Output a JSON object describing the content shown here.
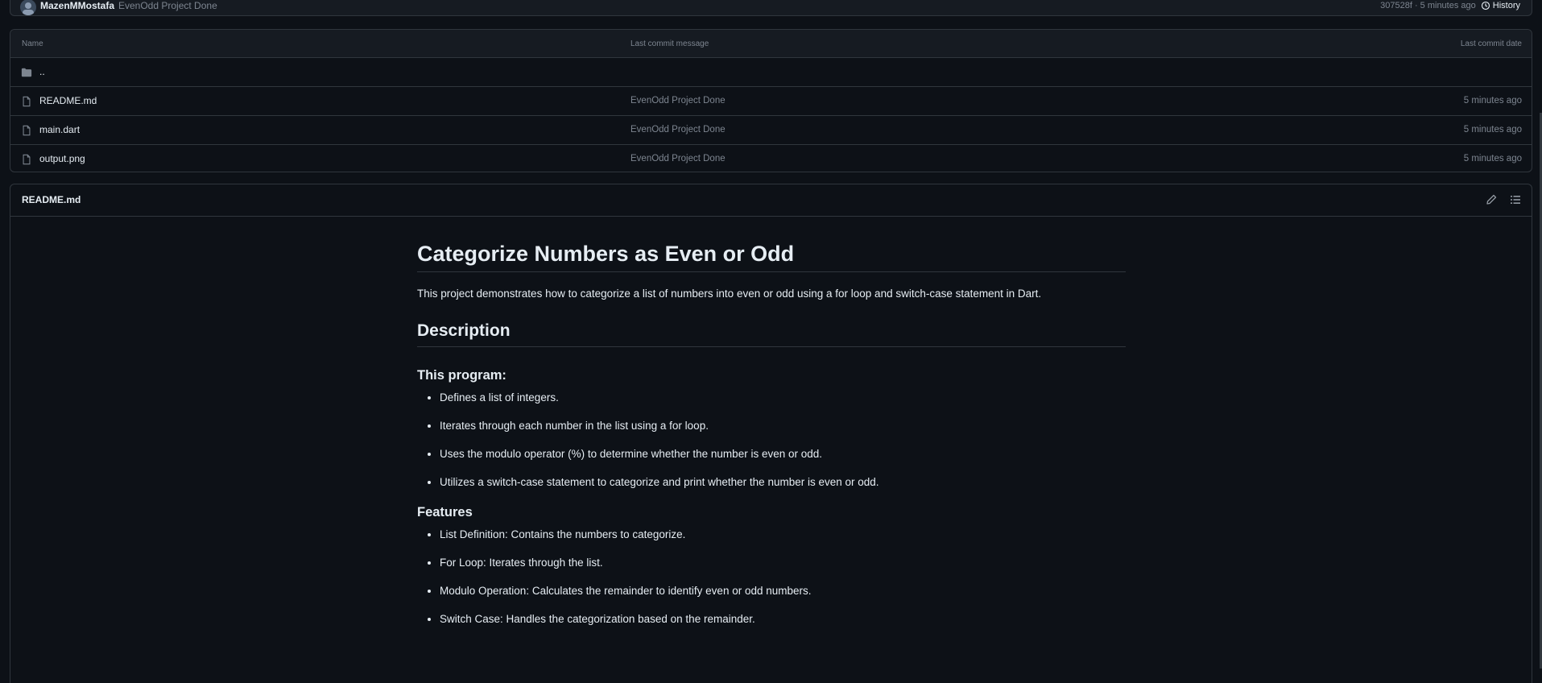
{
  "commit_bar": {
    "author": "MazenMMostafa",
    "message": "EvenOdd Project Done",
    "hash_time": "307528f · 5 minutes ago",
    "history_label": "History"
  },
  "file_table": {
    "headers": {
      "name": "Name",
      "message": "Last commit message",
      "date": "Last commit date"
    },
    "parent_label": "..",
    "files": [
      {
        "name": "README.md",
        "message": "EvenOdd Project Done",
        "date": "5 minutes ago"
      },
      {
        "name": "main.dart",
        "message": "EvenOdd Project Done",
        "date": "5 minutes ago"
      },
      {
        "name": "output.png",
        "message": "EvenOdd Project Done",
        "date": "5 minutes ago"
      }
    ]
  },
  "readme": {
    "header_title": "README.md",
    "h1": "Categorize Numbers as Even or Odd",
    "intro": "This project demonstrates how to categorize a list of numbers into even or odd using a for loop and switch-case statement in Dart.",
    "h2_description": "Description",
    "h3_program": "This program:",
    "program_items": [
      "Defines a list of integers.",
      "Iterates through each number in the list using a for loop.",
      "Uses the modulo operator (%) to determine whether the number is even or odd.",
      "Utilizes a switch-case statement to categorize and print whether the number is even or odd."
    ],
    "h3_features": "Features",
    "feature_items": [
      "List Definition: Contains the numbers to categorize.",
      "For Loop: Iterates through the list.",
      "Modulo Operation: Calculates the remainder to identify even or odd numbers.",
      "Switch Case: Handles the categorization based on the remainder."
    ]
  }
}
